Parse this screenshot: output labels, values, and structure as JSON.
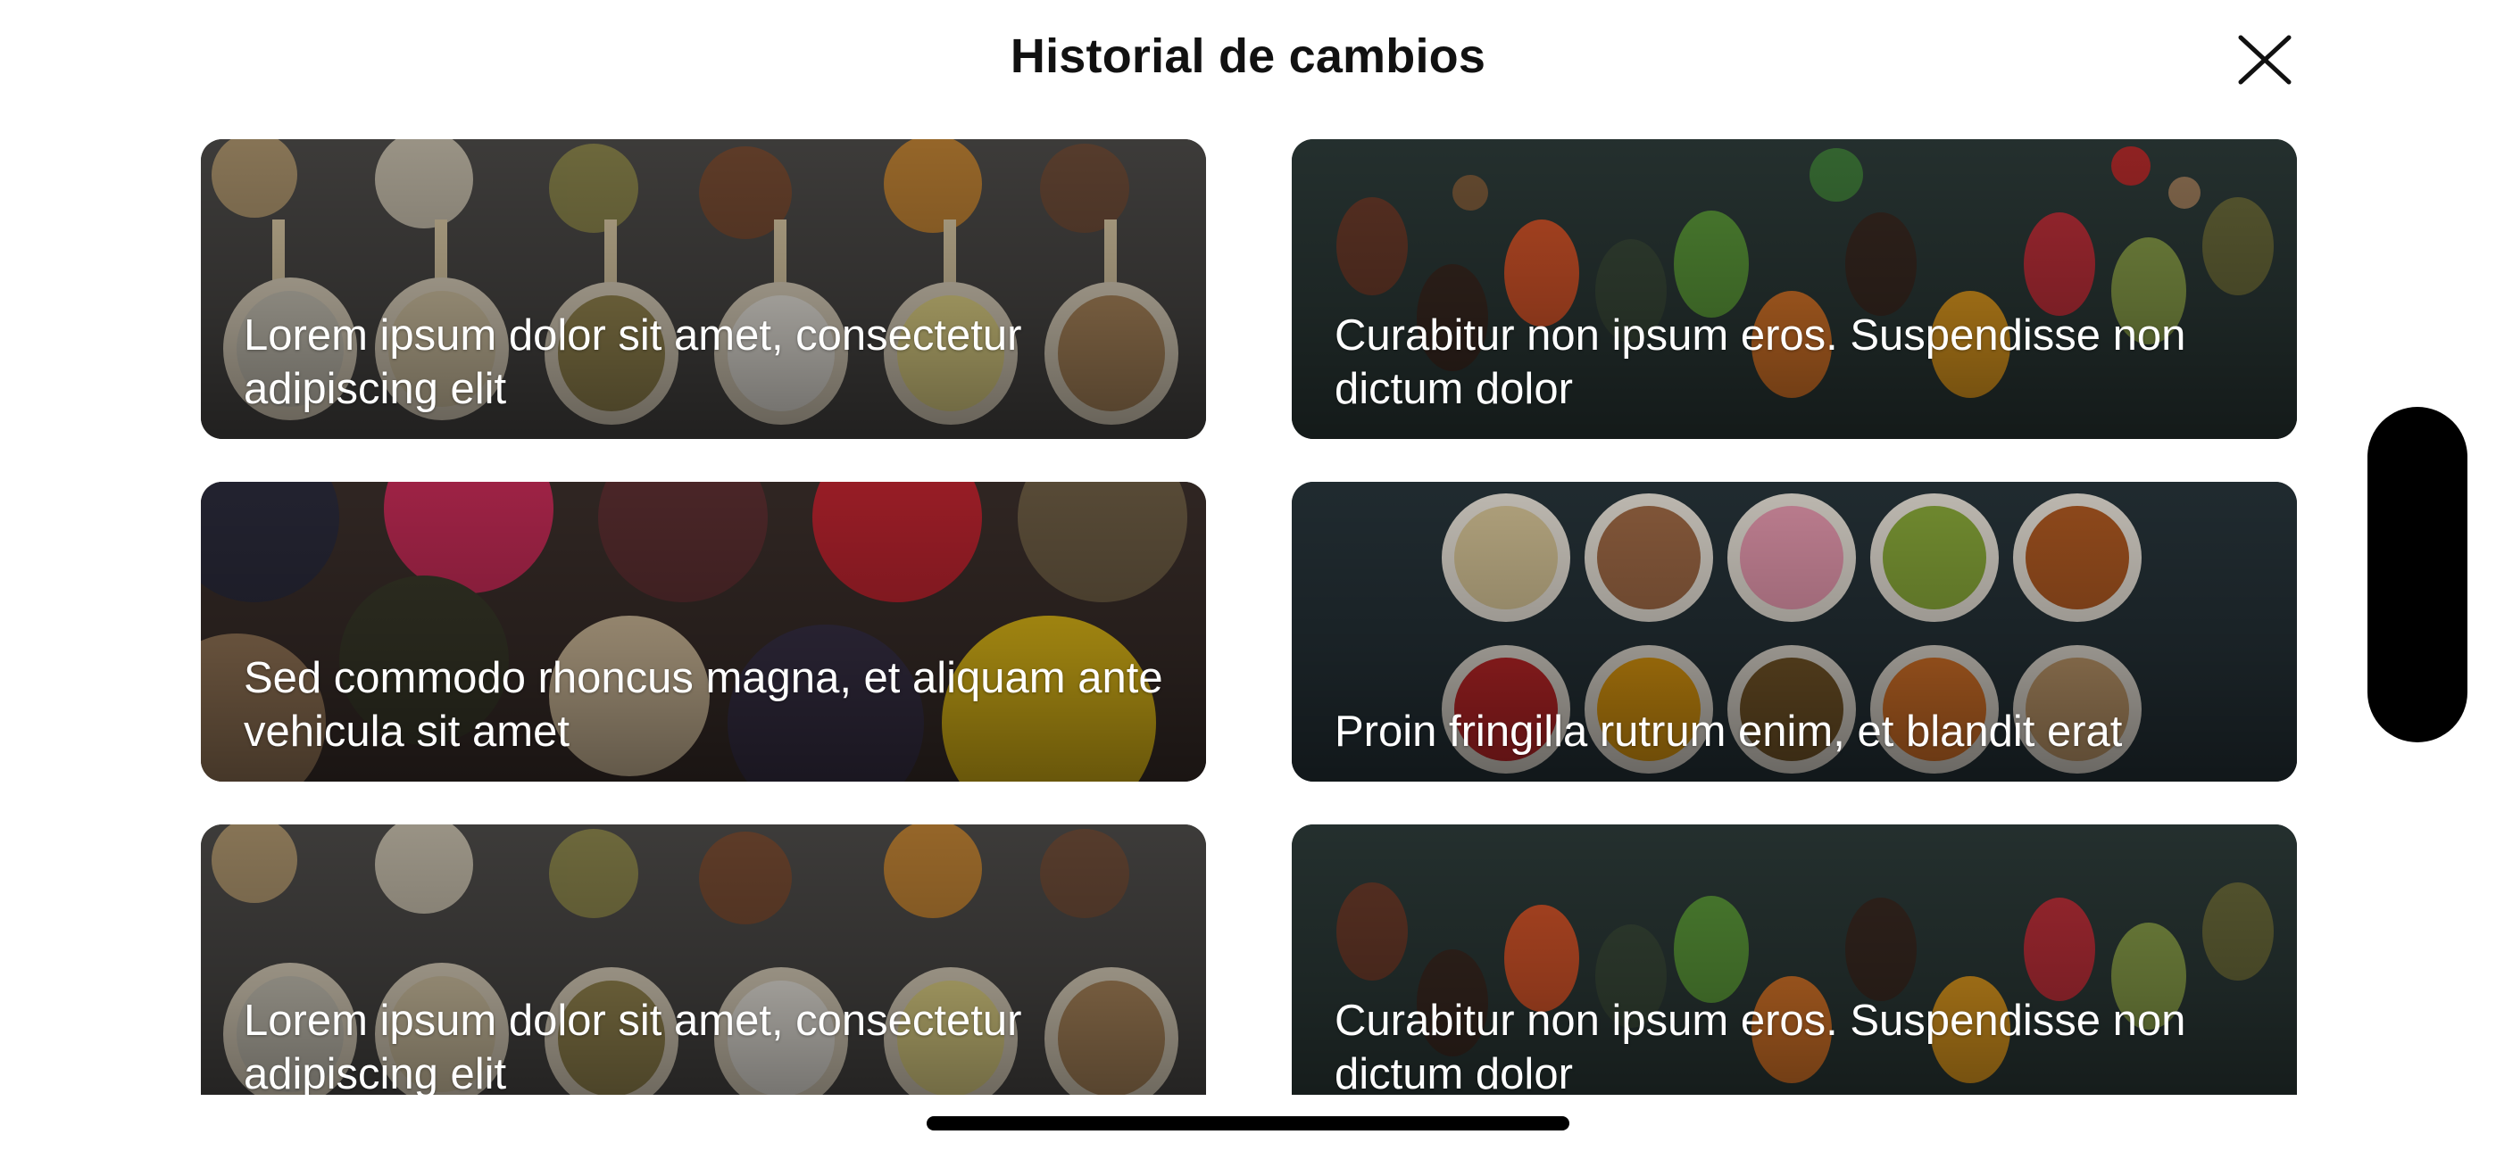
{
  "header": {
    "title": "Historial de cambios",
    "close_icon": "close-icon"
  },
  "cards": [
    {
      "caption": "Lorem ipsum dolor sit amet, consectetur adipiscing elit",
      "image": "spoons-grains-dark"
    },
    {
      "caption": "Curabitur non ipsum eros. Suspendisse non dictum dolor",
      "image": "spoons-colorful-spices"
    },
    {
      "caption": "Sed commodo rhoncus magna, et aliquam ante vehicula sit amet",
      "image": "bowls-dried-fruits"
    },
    {
      "caption": "Proin fringilla rutrum enim, et blandit erat",
      "image": "bowls-powders-teal"
    },
    {
      "caption": "Lorem ipsum dolor sit amet, consectetur adipiscing elit",
      "image": "spoons-grains-dark"
    },
    {
      "caption": "Curabitur non ipsum eros. Suspendisse non dictum dolor",
      "image": "spoons-colorful-spices"
    }
  ],
  "colors": {
    "background": "#ffffff",
    "title": "#111111",
    "caption": "#ffffff",
    "handle": "#000000"
  }
}
